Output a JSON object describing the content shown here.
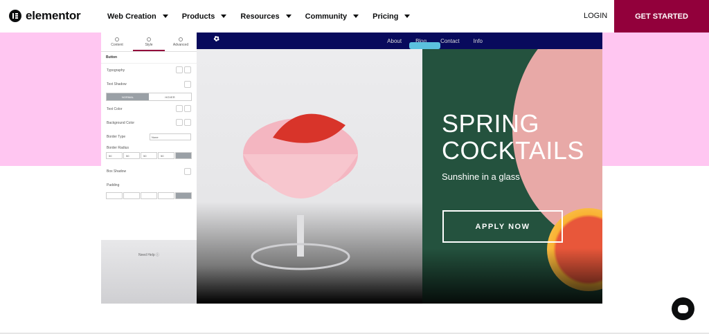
{
  "brand": {
    "name": "elementor",
    "accent": "#92003b",
    "pink": "#ffc6f1"
  },
  "nav": {
    "items": [
      {
        "label": "Web Creation"
      },
      {
        "label": "Products"
      },
      {
        "label": "Resources"
      },
      {
        "label": "Community"
      },
      {
        "label": "Pricing"
      }
    ],
    "login": "LOGIN",
    "cta": "GET STARTED"
  },
  "editor": {
    "tabs": [
      "Content",
      "Style",
      "Advanced"
    ],
    "section": "Button",
    "typography": "Typography",
    "text_shadow": "Text Shadow",
    "normal": "NORMAL",
    "hover": "HOVER",
    "text_color": "Text Color",
    "background_color": "Background Color",
    "border_type": "Border Type",
    "border_type_value": "None",
    "border_radius": "Border Radius",
    "radius_values": [
      "50",
      "50",
      "50",
      "50"
    ],
    "box_shadow": "Box Shadow",
    "padding": "Padding",
    "need_help": "Need Help"
  },
  "site": {
    "links": [
      "About",
      "Blog",
      "Contact",
      "Info"
    ],
    "title_line1": "SPRING",
    "title_line2": "COCKTAILS",
    "subtitle": "Sunshine in a glass",
    "button": "APPLY NOW"
  },
  "chat_icon": "chat-bubble-icon"
}
